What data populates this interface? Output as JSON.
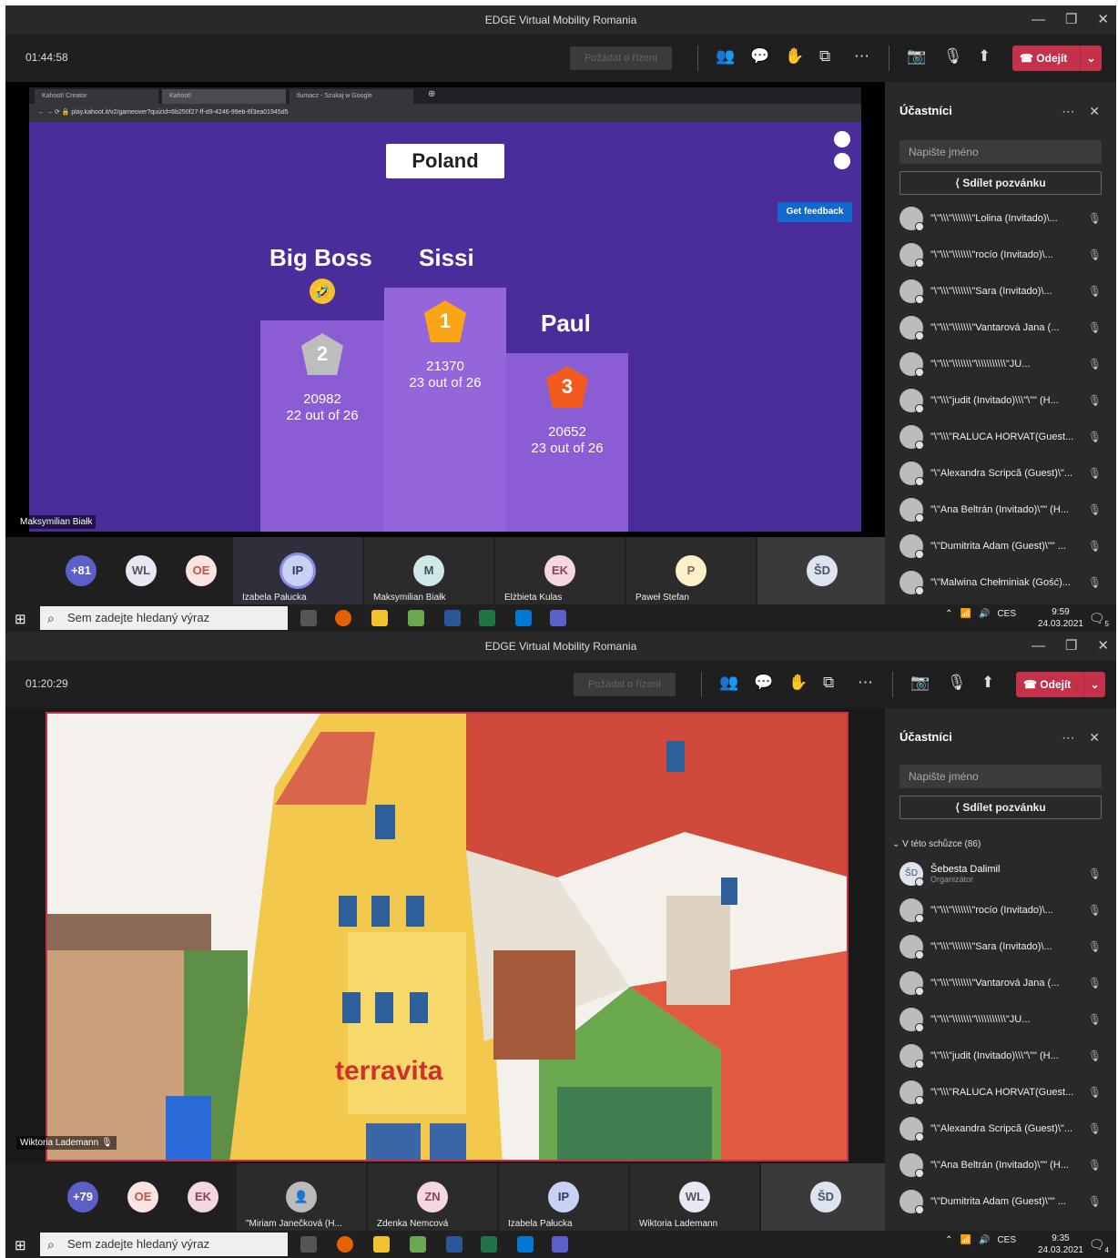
{
  "window": {
    "title": "EDGE Virtual Mobility Romania",
    "request_control": "Požádat o řízení",
    "leave": "Odejít"
  },
  "shot1": {
    "timer": "01:44:58",
    "browser": {
      "tabs": [
        "Kahoot! Creator",
        "Kahoot!",
        "tlumacz - Szukaj w Google"
      ],
      "url": "play.kahoot.it/v2/gameover?quizId=6b250f27-ff-d9-4246-99eb-6f3ea01945d5"
    },
    "kahoot": {
      "country": "Poland",
      "feedback_button": "Get feedback",
      "podium": [
        {
          "rank": "2",
          "name": "Big Boss",
          "score": "20982",
          "detail": "22 out of 26"
        },
        {
          "rank": "1",
          "name": "Sissi",
          "score": "21370",
          "detail": "23 out of 26"
        },
        {
          "rank": "3",
          "name": "Paul",
          "score": "20652",
          "detail": "23 out of 26"
        }
      ]
    },
    "speaker": "Maksymilian Białk",
    "gallery": [
      {
        "initials": "+81",
        "name": ""
      },
      {
        "initials": "WL",
        "name": ""
      },
      {
        "initials": "OE",
        "name": ""
      },
      {
        "initials": "IP",
        "name": "Izabela Pałucka"
      },
      {
        "initials": "M",
        "name": "Maksymilian Białk"
      },
      {
        "initials": "EK",
        "name": "Elżbieta Kulas"
      },
      {
        "initials": "P",
        "name": "Paweł Stefan"
      },
      {
        "initials": "ŠD",
        "name": ""
      }
    ],
    "panel": {
      "title": "Účastníci",
      "search_placeholder": "Napište jméno",
      "share": "Sdílet pozvánku",
      "participants": [
        "\"\\\"\\\\\\\"\\\\\\\\\\\\\\\"Lolina (Invitado)\\...",
        "\"\\\"\\\\\\\"\\\\\\\\\\\\\\\"rocío (Invitado)\\...",
        "\"\\\"\\\\\\\"\\\\\\\\\\\\\\\"Sara (Invitado)\\...",
        "\"\\\"\\\\\\\"\\\\\\\\\\\\\\\"Vantarová Jana (...",
        "\"\\\"\\\\\\\"\\\\\\\\\\\\\\\"\\\\\\\\\\\\\\\\\\\\\\\"JU...",
        "\"\\\"\\\\\\\"judit (Invitado)\\\\\\\"\\\"\" (H...",
        "\"\\\"\\\\\\\"RALUCA HORVAT(Guest...",
        "\"\\\"Alexandra Scripcă (Guest)\\\"...",
        "\"\\\"Ana Beltrán (Invitado)\\\"\" (H...",
        "\"\\\"Dumitrita Adam (Guest)\\\"\" ...",
        "\"\\\"Malwina Chełminiak (Gość)..."
      ]
    },
    "taskbar": {
      "search": "Sem zadejte hledaný výraz",
      "lang": "CES",
      "time": "9:59",
      "date": "24.03.2021",
      "notif": "5"
    }
  },
  "shot2": {
    "timer": "01:20:29",
    "speaker": "Wiktoria Lademann",
    "gallery": [
      {
        "initials": "+79",
        "name": ""
      },
      {
        "initials": "OE",
        "name": ""
      },
      {
        "initials": "EK",
        "name": ""
      },
      {
        "initials": "",
        "name": "\"Miriam Janečková (H..."
      },
      {
        "initials": "ZN",
        "name": "Zdenka Nemcová"
      },
      {
        "initials": "IP",
        "name": "Izabela Pałucka"
      },
      {
        "initials": "WL",
        "name": "Wiktoria Lademann"
      },
      {
        "initials": "ŠD",
        "name": ""
      }
    ],
    "panel": {
      "title": "Účastníci",
      "search_placeholder": "Napište jméno",
      "share": "Sdílet pozvánku",
      "section": "V této schůzce (86)",
      "organizer": {
        "initials": "ŠD",
        "name": "Šebesta Dalimil",
        "role": "Organizátor"
      },
      "participants": [
        "\"\\\"\\\\\\\"\\\\\\\\\\\\\\\"rocío (Invitado)\\...",
        "\"\\\"\\\\\\\"\\\\\\\\\\\\\\\"Sara (Invitado)\\...",
        "\"\\\"\\\\\\\"\\\\\\\\\\\\\\\"Vantarová Jana (...",
        "\"\\\"\\\\\\\"\\\\\\\\\\\\\\\"\\\\\\\\\\\\\\\\\\\\\\\"JU...",
        "\"\\\"\\\\\\\"judit (Invitado)\\\\\\\"\\\"\" (H...",
        "\"\\\"\\\\\\\"RALUCA HORVAT(Guest...",
        "\"\\\"Alexandra Scripcă (Guest)\\\"...",
        "\"\\\"Ana Beltrán (Invitado)\\\"\" (H...",
        "\"\\\"Dumitrita Adam (Guest)\\\"\" ..."
      ]
    },
    "shop_sign": "terravita",
    "taskbar": {
      "search": "Sem zadejte hledaný výraz",
      "lang": "CES",
      "time": "9:35",
      "date": "24.03.2021",
      "notif": "4"
    }
  },
  "colors": {
    "accent_red": "#c4314b",
    "kahoot_purple": "#4b2c9b",
    "teams_dark": "#1f1f1f"
  }
}
